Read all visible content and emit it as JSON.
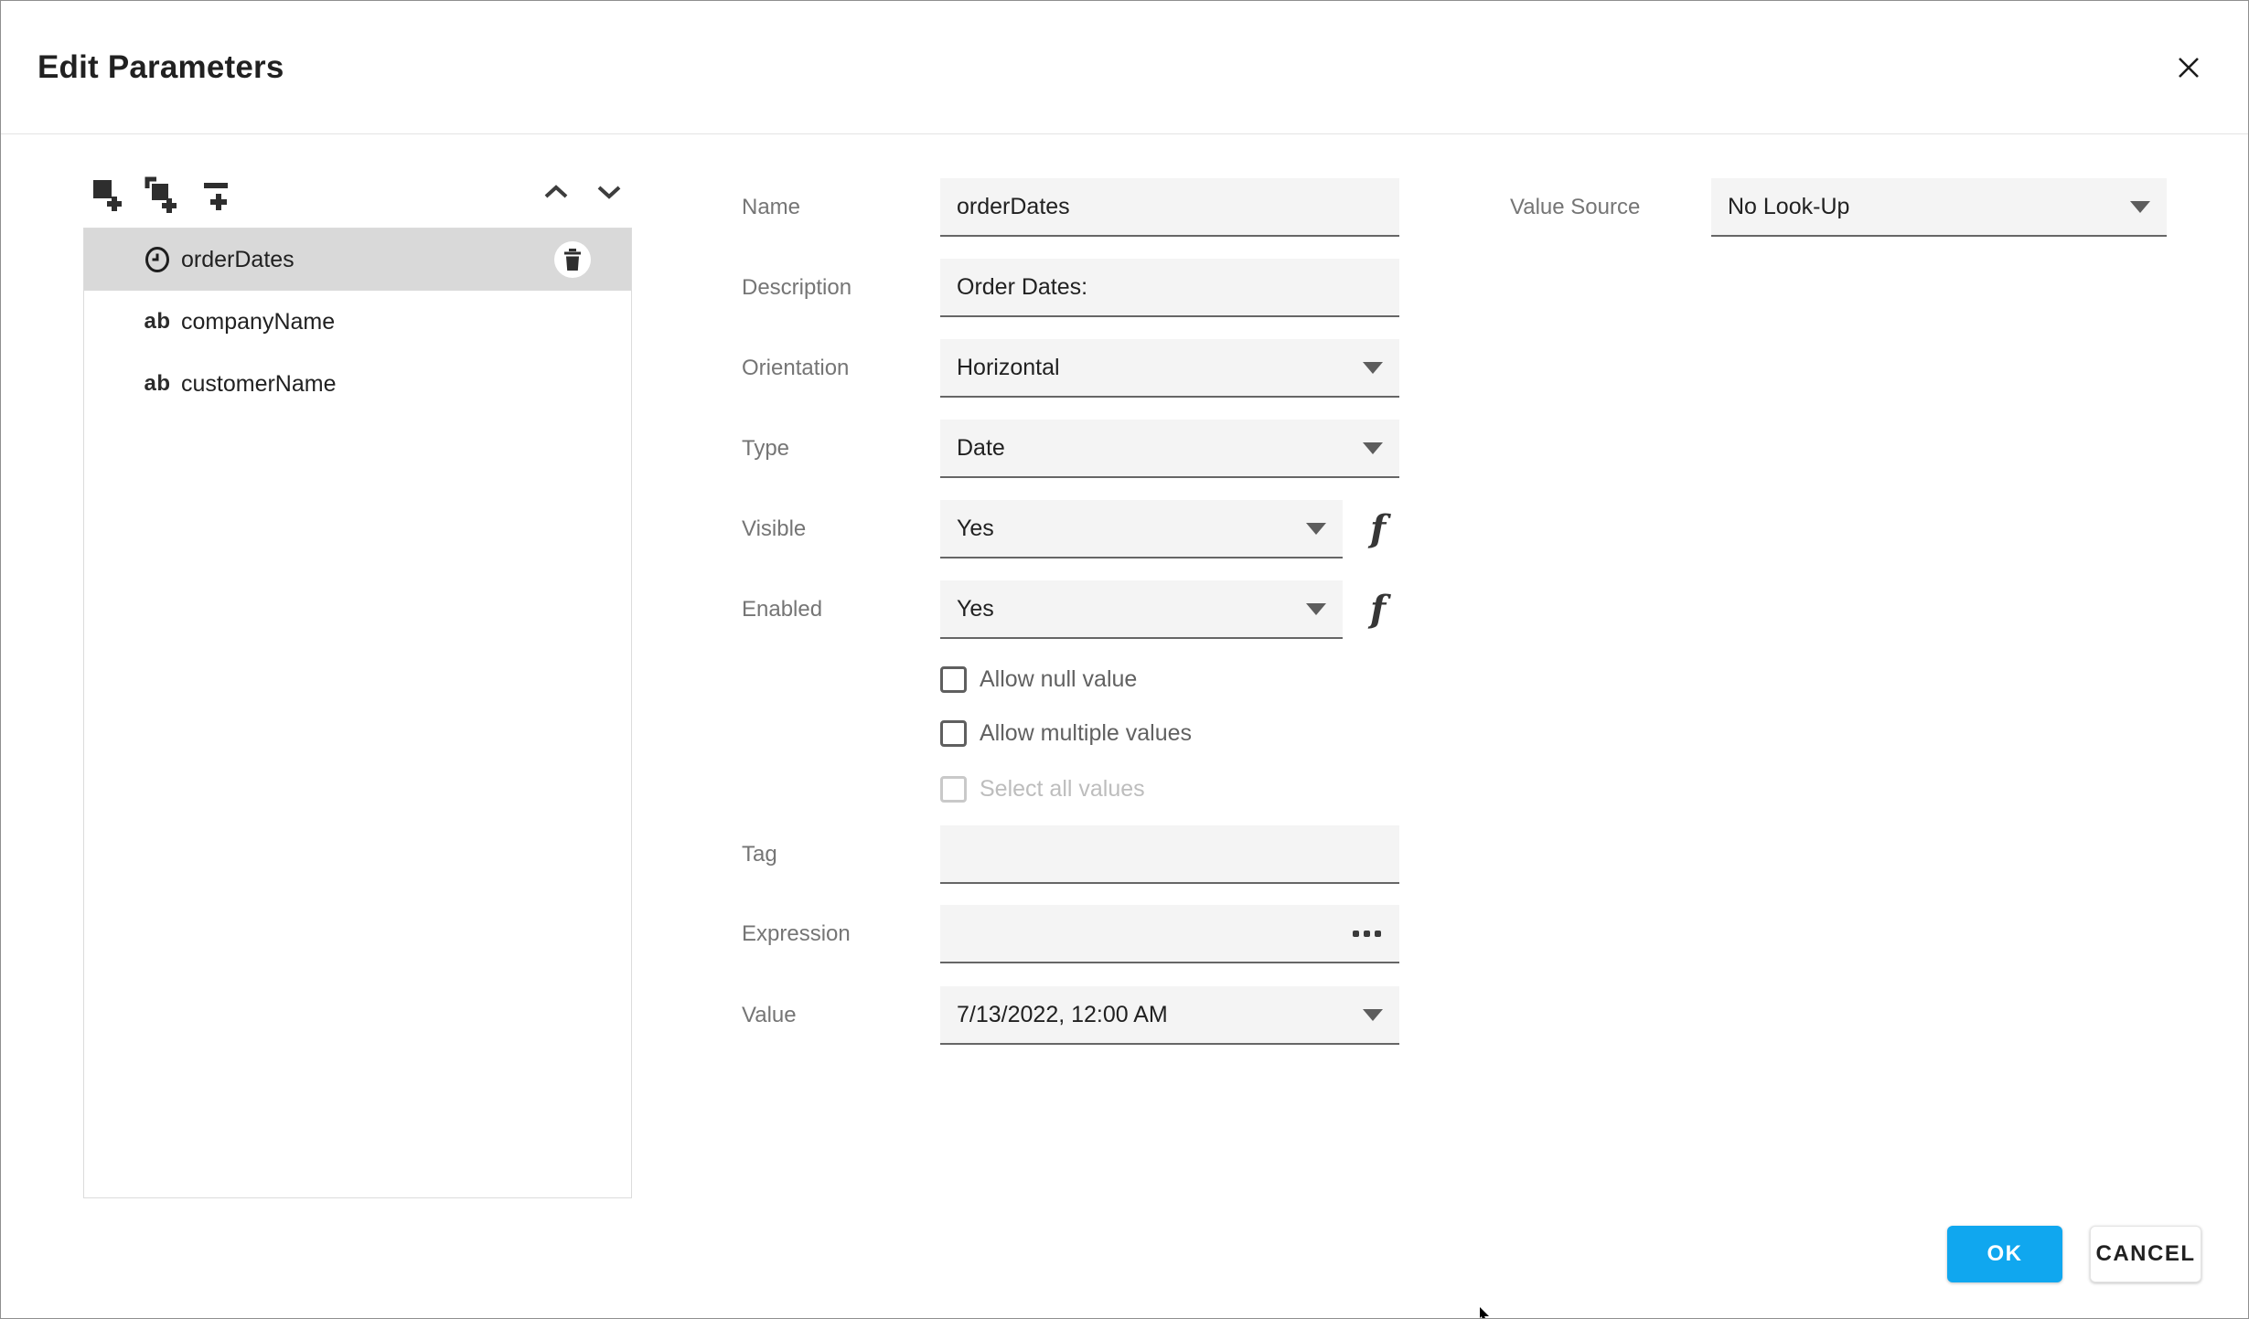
{
  "window": {
    "title": "Edit Parameters"
  },
  "icons": {
    "close": "close-icon",
    "add_parameter": "add-parameter-icon",
    "add_group": "add-parameter-group-icon",
    "add_separator": "add-separator-icon",
    "move_up": "chevron-up-icon",
    "move_down": "chevron-down-icon",
    "delete": "trash-icon",
    "date_parameter": "clock-icon",
    "string_parameter_glyph": "ab",
    "function_glyph": "f",
    "dropdown": "triangle-down",
    "ellipsis": "more-dots"
  },
  "colors": {
    "accent": "#10a7ef",
    "selected_row": "#d9d9d9",
    "field_background": "#f4f4f4",
    "field_underline": "#666666",
    "label_grey": "#757575",
    "text": "#212121"
  },
  "left_panel": {
    "parameters": [
      {
        "name": "orderDates",
        "icon": "clock",
        "selected": true
      },
      {
        "name": "companyName",
        "icon": "ab",
        "selected": false
      },
      {
        "name": "customerName",
        "icon": "ab",
        "selected": false
      }
    ]
  },
  "form": {
    "name": {
      "label": "Name",
      "value": "orderDates"
    },
    "description": {
      "label": "Description",
      "value": "Order Dates:"
    },
    "orientation": {
      "label": "Orientation",
      "value": "Horizontal"
    },
    "type": {
      "label": "Type",
      "value": "Date"
    },
    "visible": {
      "label": "Visible",
      "value": "Yes"
    },
    "enabled": {
      "label": "Enabled",
      "value": "Yes"
    },
    "checkboxes": [
      {
        "label": "Allow null value",
        "checked": false,
        "disabled": false
      },
      {
        "label": "Allow multiple values",
        "checked": false,
        "disabled": false
      },
      {
        "label": "Select all values",
        "checked": false,
        "disabled": true
      }
    ],
    "tag": {
      "label": "Tag",
      "value": ""
    },
    "expression": {
      "label": "Expression",
      "value": ""
    },
    "value": {
      "label": "Value",
      "value": "7/13/2022, 12:00 AM"
    }
  },
  "value_source": {
    "label": "Value Source",
    "value": "No Look-Up"
  },
  "footer": {
    "ok_label": "OK",
    "cancel_label": "CANCEL"
  }
}
